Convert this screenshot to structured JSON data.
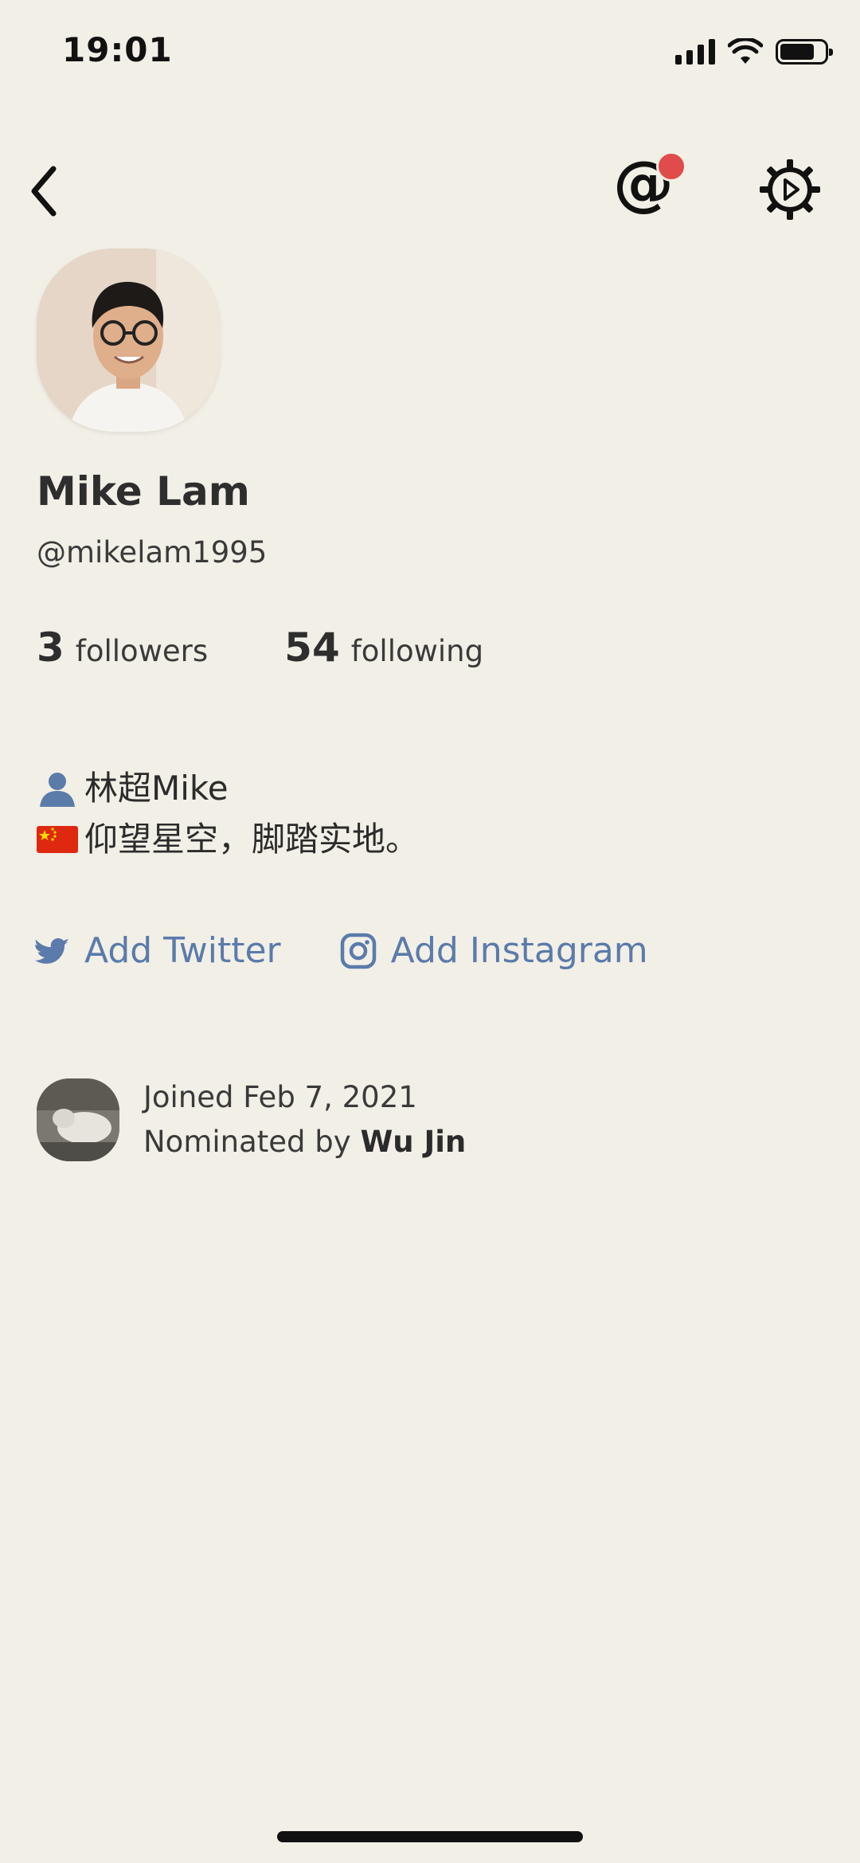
{
  "status_bar": {
    "time": "19:01",
    "icons": [
      "cellular-signal-icon",
      "wifi-icon",
      "battery-icon"
    ]
  },
  "nav": {
    "back_icon": "chevron-left-icon",
    "mention_icon": "at-sign-icon",
    "mention_glyph": "@",
    "has_notification": true,
    "settings_icon": "gear-icon"
  },
  "profile": {
    "display_name": "Mike Lam",
    "username": "@mikelam1995",
    "followers_count": "3",
    "followers_label": "followers",
    "following_count": "54",
    "following_label": "following",
    "bio": [
      {
        "emoji": "person-silhouette",
        "text": "林超Mike"
      },
      {
        "emoji": "china-flag",
        "text": "仰望星空，脚踏实地。"
      }
    ]
  },
  "social": {
    "twitter_label": "Add Twitter",
    "instagram_label": "Add Instagram"
  },
  "joined": {
    "joined_text": "Joined Feb 7, 2021",
    "nominated_prefix": "Nominated by ",
    "nominator_name": "Wu Jin"
  },
  "colors": {
    "background": "#f2efe6",
    "link": "#5a7bab",
    "notification_dot": "#e04b4b",
    "text": "#2b2b2b"
  }
}
